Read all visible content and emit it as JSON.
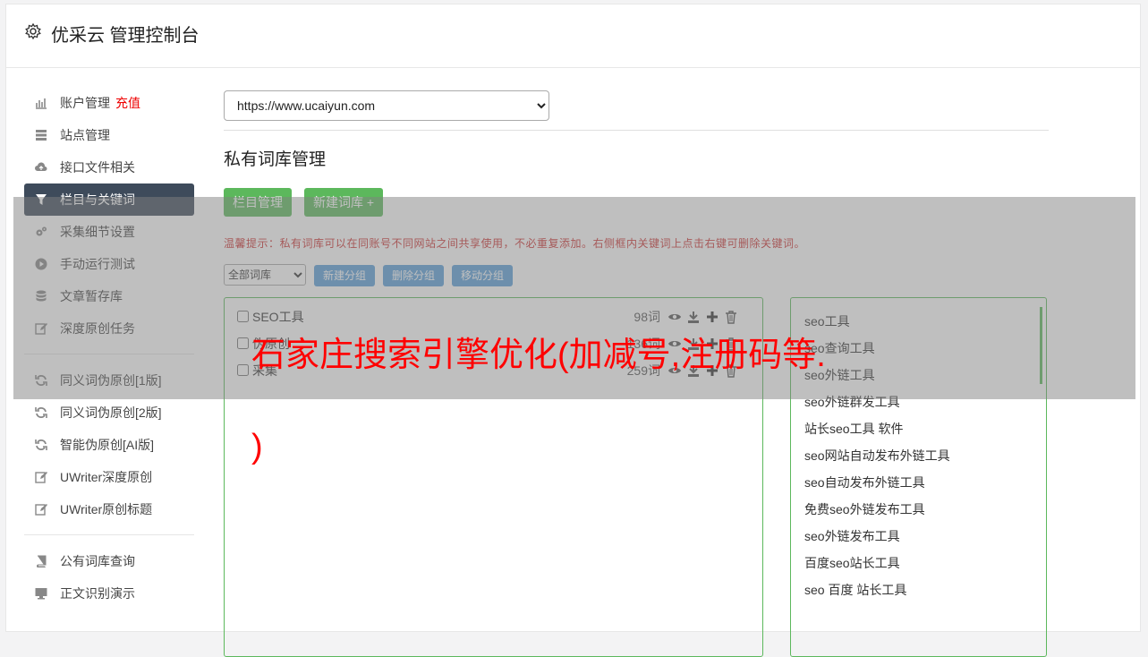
{
  "header": {
    "title": "优采云 管理控制台",
    "icon": "gear-icon"
  },
  "sidebar": {
    "items": [
      {
        "label": "账户管理",
        "highlight": "充值",
        "icon": "bar-chart-icon"
      },
      {
        "label": "站点管理",
        "icon": "server-icon"
      },
      {
        "label": "接口文件相关",
        "icon": "cloud-upload-icon"
      },
      {
        "label": "栏目与关键词",
        "icon": "filter-icon",
        "active": true
      },
      {
        "label": "采集细节设置",
        "icon": "cogs-icon"
      },
      {
        "label": "手动运行测试",
        "icon": "play-circle-icon"
      },
      {
        "label": "文章暂存库",
        "icon": "database-icon"
      },
      {
        "label": "深度原创任务",
        "icon": "edit-icon"
      },
      {
        "label": "同义词伪原创[1版]",
        "icon": "refresh-icon"
      },
      {
        "label": "同义词伪原创[2版]",
        "icon": "refresh-icon"
      },
      {
        "label": "智能伪原创[AI版]",
        "icon": "refresh-icon"
      },
      {
        "label": "UWriter深度原创",
        "icon": "edit-icon"
      },
      {
        "label": "UWriter原创标题",
        "icon": "edit-icon"
      },
      {
        "label": "公有词库查询",
        "icon": "book-icon"
      },
      {
        "label": "正文识别演示",
        "icon": "monitor-icon"
      }
    ]
  },
  "main": {
    "site_select": "https://www.ucaiyun.com",
    "section_title": "私有词库管理",
    "btn_column": "栏目管理",
    "btn_new_lib": "新建词库 +",
    "tip": "温馨提示：私有词库可以在同账号不同网站之间共享使用，不必重复添加。右侧框内关键词上点击右键可删除关键词。",
    "group_select": "全部词库",
    "btn_new_group": "新建分组",
    "btn_del_group": "删除分组",
    "btn_move_group": "移动分组",
    "libraries": [
      {
        "name": "SEO工具",
        "count": "98词"
      },
      {
        "name": "伪原创",
        "count": "136词"
      },
      {
        "name": "采集",
        "count": "259词"
      }
    ],
    "keywords": [
      "seo工具",
      "seo查询工具",
      "seo外链工具",
      "seo外链群发工具",
      "站长seo工具 软件",
      "seo网站自动发布外链工具",
      "seo自动发布外链工具",
      "免费seo外链发布工具",
      "seo外链发布工具",
      "百度seo站长工具",
      "seo 百度 站长工具"
    ]
  },
  "overlay": {
    "line1": "石家庄搜索引擎优化(加减号,注册码等.",
    "line2": ")"
  },
  "colors": {
    "accent_green": "#5cb85c",
    "accent_blue": "#5a9fd8",
    "active_nav": "#3e4b5b",
    "warn": "#e00"
  }
}
